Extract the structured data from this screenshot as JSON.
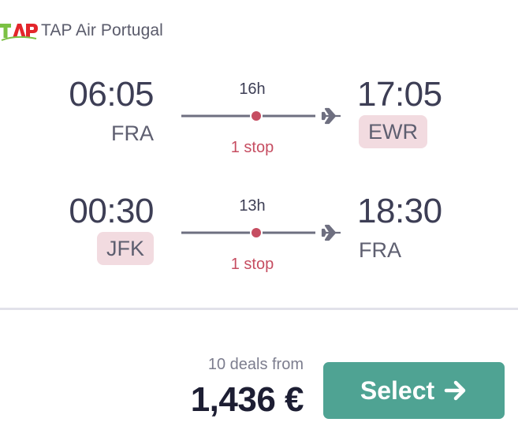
{
  "airline": {
    "logo_text": "TAP",
    "name": "TAP Air Portugal",
    "logo_colors": {
      "green": "#7bc143",
      "red": "#e3262b"
    }
  },
  "legs": [
    {
      "departure_time": "06:05",
      "departure_airport": "FRA",
      "departure_airport_highlighted": false,
      "duration": "16h",
      "stops": "1 stop",
      "arrival_time": "17:05",
      "arrival_airport": "EWR",
      "arrival_airport_highlighted": true
    },
    {
      "departure_time": "00:30",
      "departure_airport": "JFK",
      "departure_airport_highlighted": true,
      "duration": "13h",
      "stops": "1 stop",
      "arrival_time": "18:30",
      "arrival_airport": "FRA",
      "arrival_airport_highlighted": false
    }
  ],
  "footer": {
    "deals_text": "10 deals from",
    "price": "1,436 €",
    "select_label": "Select"
  },
  "colors": {
    "accent": "#4fa393",
    "stop_red": "#c64d61",
    "highlight_bg": "#f2dbe0",
    "text_dark": "#1d1e33"
  },
  "icons": {
    "plane": "airplane-icon",
    "arrow": "arrow-right-icon",
    "stop_dot": "stop-dot-icon"
  }
}
